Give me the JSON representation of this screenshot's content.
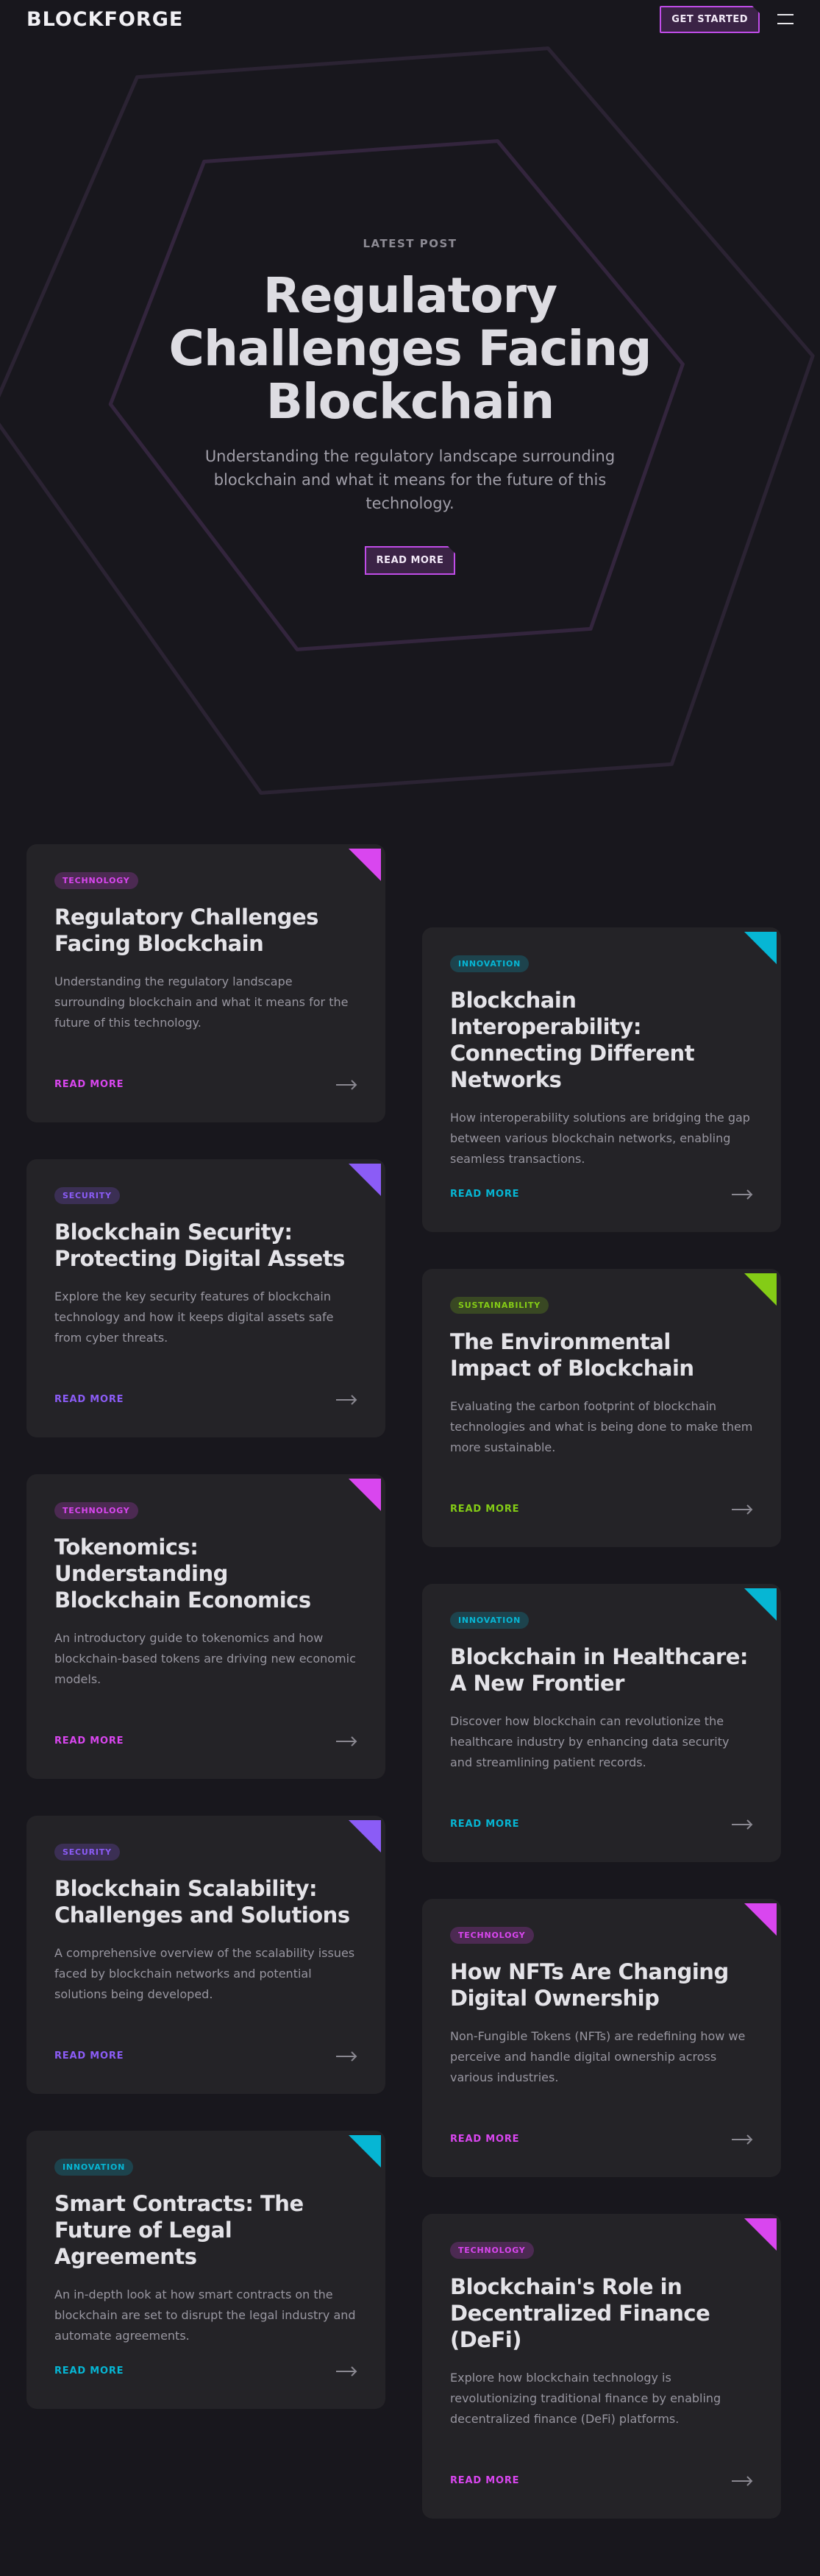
{
  "header": {
    "logo": "BLOCKFORGE",
    "cta_label": "GET STARTED"
  },
  "hero": {
    "eyebrow": "LATEST POST",
    "title": "Regulatory Challenges Facing Blockchain",
    "subtitle": "Understanding the regulatory landscape surrounding blockchain and what it means for the future of this technology.",
    "button_label": "READ MORE"
  },
  "colors": {
    "background": "#18171d",
    "card": "#242327",
    "technology": "#d946ef",
    "innovation": "#06b6d4",
    "security": "#8b5cf6",
    "sustainability": "#84cc16"
  },
  "posts": [
    {
      "category": "TECHNOLOGY",
      "title": "Regulatory Challenges Facing Blockchain",
      "description": "Understanding the regulatory landscape surrounding blockchain and what it means for the future of this technology.",
      "link_label": "READ MORE"
    },
    {
      "category": "INNOVATION",
      "title": "Blockchain Interoperability: Connecting Different Networks",
      "description": "How interoperability solutions are bridging the gap between various blockchain networks, enabling seamless transactions.",
      "link_label": "READ MORE"
    },
    {
      "category": "SECURITY",
      "title": "Blockchain Security: Protecting Digital Assets",
      "description": "Explore the key security features of blockchain technology and how it keeps digital assets safe from cyber threats.",
      "link_label": "READ MORE"
    },
    {
      "category": "SUSTAINABILITY",
      "title": "The Environmental Impact of Blockchain",
      "description": "Evaluating the carbon footprint of blockchain technologies and what is being done to make them more sustainable.",
      "link_label": "READ MORE"
    },
    {
      "category": "TECHNOLOGY",
      "title": "Tokenomics: Understanding Blockchain Economics",
      "description": "An introductory guide to tokenomics and how blockchain-based tokens are driving new economic models.",
      "link_label": "READ MORE"
    },
    {
      "category": "INNOVATION",
      "title": "Blockchain in Healthcare: A New Frontier",
      "description": "Discover how blockchain can revolutionize the healthcare industry by enhancing data security and streamlining patient records.",
      "link_label": "READ MORE"
    },
    {
      "category": "SECURITY",
      "title": "Blockchain Scalability: Challenges and Solutions",
      "description": "A comprehensive overview of the scalability issues faced by blockchain networks and potential solutions being developed.",
      "link_label": "READ MORE"
    },
    {
      "category": "TECHNOLOGY",
      "title": "How NFTs Are Changing Digital Ownership",
      "description": "Non-Fungible Tokens (NFTs) are redefining how we perceive and handle digital ownership across various industries.",
      "link_label": "READ MORE"
    },
    {
      "category": "INNOVATION",
      "title": "Smart Contracts: The Future of Legal Agreements",
      "description": "An in-depth look at how smart contracts on the blockchain are set to disrupt the legal industry and automate agreements.",
      "link_label": "READ MORE"
    },
    {
      "category": "TECHNOLOGY",
      "title": "Blockchain's Role in Decentralized Finance (DeFi)",
      "description": "Explore how blockchain technology is revolutionizing traditional finance by enabling decentralized finance (DeFi) platforms.",
      "link_label": "READ MORE"
    }
  ]
}
